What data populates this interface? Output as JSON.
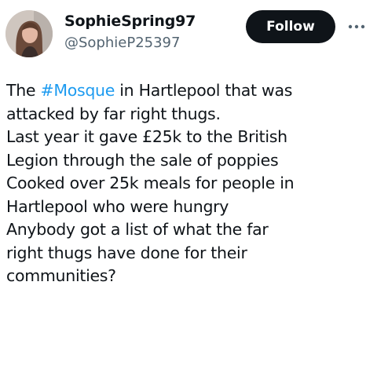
{
  "user": {
    "display_name": "SophieSpring97",
    "handle": "@SophieP25397"
  },
  "actions": {
    "follow_label": "Follow",
    "more_icon": "more-horizontal-icon"
  },
  "tweet": {
    "line1_before": "The ",
    "hashtag": "#Mosque",
    "line1_after": " in Hartlepool that was",
    "lines": [
      "attacked by far right thugs.",
      "Last year it gave £25k to the British",
      "Legion through the sale of poppies",
      "Cooked over 25k meals for people in",
      "Hartlepool who were hungry",
      "Anybody got a list of what the far",
      "right thugs have done for their",
      "communities?"
    ]
  },
  "colors": {
    "text": "#0f1419",
    "secondary": "#536471",
    "link": "#1d9bf0",
    "button_bg": "#0f1419",
    "button_text": "#ffffff"
  }
}
